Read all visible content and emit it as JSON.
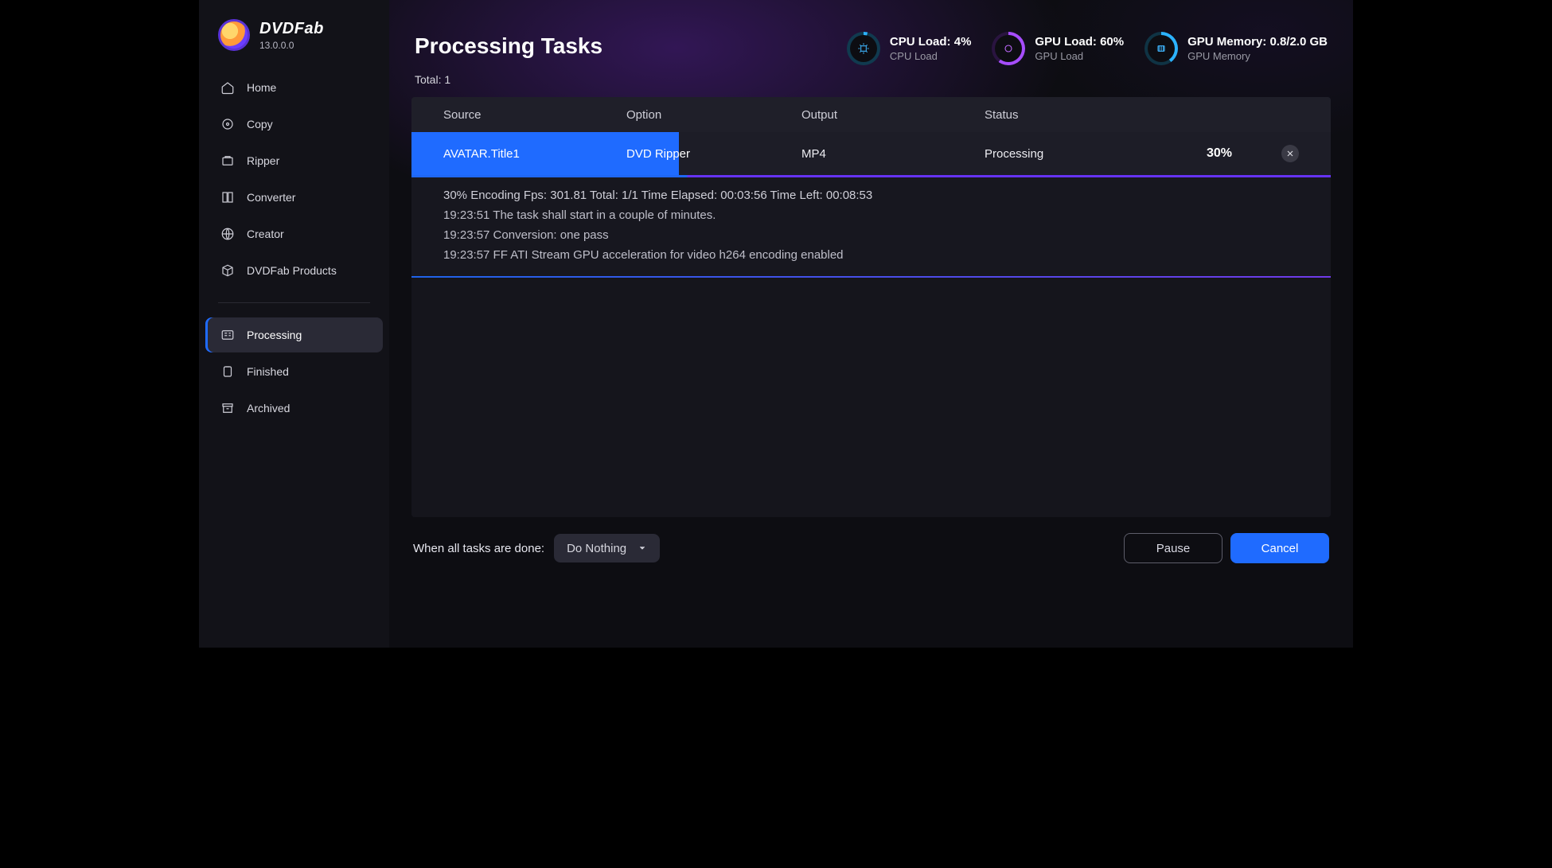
{
  "brand": {
    "name": "DVDFab",
    "version": "13.0.0.0"
  },
  "window": {
    "queue_icon": "queue",
    "menu_icon": "menu",
    "min_icon": "minimize",
    "max_icon": "maximize",
    "close_icon": "close"
  },
  "sidebar": {
    "groups": [
      {
        "items": [
          {
            "id": "home",
            "label": "Home",
            "icon": "home"
          },
          {
            "id": "copy",
            "label": "Copy",
            "icon": "copy"
          },
          {
            "id": "ripper",
            "label": "Ripper",
            "icon": "ripper"
          },
          {
            "id": "converter",
            "label": "Converter",
            "icon": "converter"
          },
          {
            "id": "creator",
            "label": "Creator",
            "icon": "globe"
          },
          {
            "id": "products",
            "label": "DVDFab Products",
            "icon": "box"
          }
        ]
      },
      {
        "items": [
          {
            "id": "processing",
            "label": "Processing",
            "icon": "tasks",
            "active": true
          },
          {
            "id": "finished",
            "label": "Finished",
            "icon": "clipboard"
          },
          {
            "id": "archived",
            "label": "Archived",
            "icon": "archive"
          }
        ]
      }
    ]
  },
  "header": {
    "title": "Processing Tasks",
    "total_label": "Total:",
    "total_value": "1",
    "gauges": {
      "cpu": {
        "title": "CPU Load: 4%",
        "sub": "CPU Load",
        "pct": 4
      },
      "gpu": {
        "title": "GPU Load: 60%",
        "sub": "GPU Load",
        "pct": 60
      },
      "mem": {
        "title": "GPU Memory: 0.8/2.0 GB",
        "sub": "GPU Memory",
        "pct": 40
      }
    }
  },
  "table": {
    "columns": {
      "source": "Source",
      "option": "Option",
      "output": "Output",
      "status": "Status"
    },
    "row": {
      "source": "AVATAR.Title1",
      "option": "DVD Ripper",
      "output": "MP4",
      "status": "Processing",
      "percent": "30%",
      "progress_pct": 30
    },
    "details": {
      "summary": "30%  Encoding Fps: 301.81   Total: 1/1  Time Elapsed: 00:03:56  Time Left: 00:08:53",
      "logs": [
        "19:23:51  The task shall start in a couple of minutes.",
        "19:23:57  Conversion: one pass",
        "19:23:57  FF ATI Stream GPU acceleration for video h264 encoding enabled"
      ]
    }
  },
  "footer": {
    "when_label": "When all tasks are done:",
    "select_value": "Do Nothing",
    "pause": "Pause",
    "cancel": "Cancel"
  }
}
